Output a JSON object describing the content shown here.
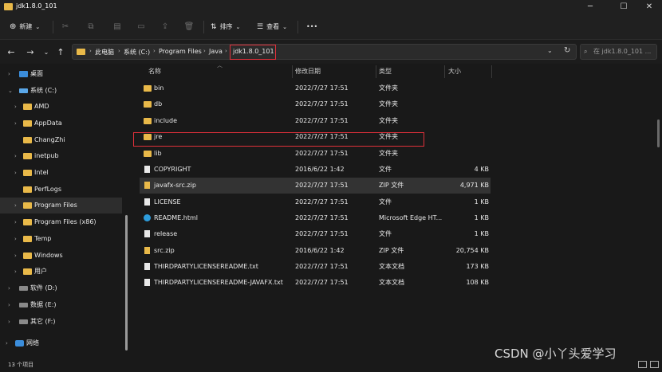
{
  "window": {
    "title": "jdk1.8.0_101",
    "minimize": "─",
    "maximize": "☐",
    "close": "✕"
  },
  "toolbar": {
    "new_label": "新建",
    "sort_label": "排序",
    "view_label": "查看",
    "more_label": "•••"
  },
  "address": {
    "crumbs": [
      "此电脑",
      "系统 (C:)",
      "Program Files",
      "Java",
      "jdk1.8.0_101"
    ],
    "search_placeholder": "在 jdk1.8.0_101 ..."
  },
  "sidebar": {
    "items": [
      {
        "label": "桌面"
      },
      {
        "label": "系统 (C:)"
      },
      {
        "label": "AMD"
      },
      {
        "label": "AppData"
      },
      {
        "label": "ChangZhi"
      },
      {
        "label": "inetpub"
      },
      {
        "label": "Intel"
      },
      {
        "label": "PerfLogs"
      },
      {
        "label": "Program Files"
      },
      {
        "label": "Program Files (x86)"
      },
      {
        "label": "Temp"
      },
      {
        "label": "Windows"
      },
      {
        "label": "用户"
      },
      {
        "label": "软件 (D:)"
      },
      {
        "label": "数据 (E:)"
      },
      {
        "label": "其它 (F:)"
      },
      {
        "label": "网络"
      }
    ]
  },
  "columns": {
    "name": "名称",
    "modified": "修改日期",
    "type": "类型",
    "size": "大小"
  },
  "files": [
    {
      "name": "bin",
      "date": "2022/7/27 17:51",
      "type": "文件夹",
      "size": "",
      "icon": "folder"
    },
    {
      "name": "db",
      "date": "2022/7/27 17:51",
      "type": "文件夹",
      "size": "",
      "icon": "folder"
    },
    {
      "name": "include",
      "date": "2022/7/27 17:51",
      "type": "文件夹",
      "size": "",
      "icon": "folder"
    },
    {
      "name": "jre",
      "date": "2022/7/27 17:51",
      "type": "文件夹",
      "size": "",
      "icon": "folder"
    },
    {
      "name": "lib",
      "date": "2022/7/27 17:51",
      "type": "文件夹",
      "size": "",
      "icon": "folder"
    },
    {
      "name": "COPYRIGHT",
      "date": "2016/6/22 1:42",
      "type": "文件",
      "size": "4 KB",
      "icon": "file"
    },
    {
      "name": "javafx-src.zip",
      "date": "2022/7/27 17:51",
      "type": "ZIP 文件",
      "size": "4,971 KB",
      "icon": "zip"
    },
    {
      "name": "LICENSE",
      "date": "2022/7/27 17:51",
      "type": "文件",
      "size": "1 KB",
      "icon": "file"
    },
    {
      "name": "README.html",
      "date": "2022/7/27 17:51",
      "type": "Microsoft Edge HT...",
      "size": "1 KB",
      "icon": "edge"
    },
    {
      "name": "release",
      "date": "2022/7/27 17:51",
      "type": "文件",
      "size": "1 KB",
      "icon": "file"
    },
    {
      "name": "src.zip",
      "date": "2016/6/22 1:42",
      "type": "ZIP 文件",
      "size": "20,754 KB",
      "icon": "zip"
    },
    {
      "name": "THIRDPARTYLICENSEREADME.txt",
      "date": "2022/7/27 17:51",
      "type": "文本文档",
      "size": "173 KB",
      "icon": "file"
    },
    {
      "name": "THIRDPARTYLICENSEREADME-JAVAFX.txt",
      "date": "2022/7/27 17:51",
      "type": "文本文档",
      "size": "108 KB",
      "icon": "file"
    }
  ],
  "status": {
    "item_count": "13 个项目"
  },
  "watermark": "CSDN @小丫头爱学习",
  "colors": {
    "highlight_red": "#e0303a",
    "folder_yellow": "#e9b949"
  }
}
